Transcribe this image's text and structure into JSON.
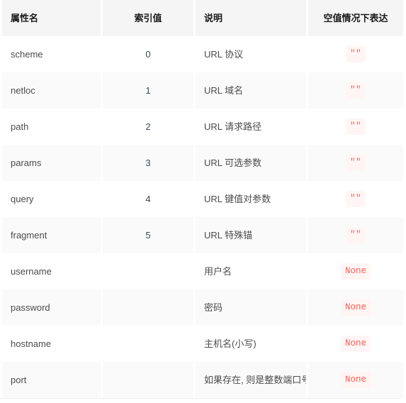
{
  "table": {
    "columns": [
      {
        "label": "属性名",
        "align": "left",
        "key": "attribute"
      },
      {
        "label": "索引值",
        "align": "center",
        "key": "index"
      },
      {
        "label": "说明",
        "align": "left",
        "key": "description"
      },
      {
        "label": "空值情况下表达",
        "align": "center",
        "key": "empty_value"
      }
    ],
    "rows": [
      {
        "attribute": "scheme",
        "index": "0",
        "description": "URL 协议",
        "empty_value": "\"\""
      },
      {
        "attribute": "netloc",
        "index": "1",
        "description": "URL 域名",
        "empty_value": "\"\""
      },
      {
        "attribute": "path",
        "index": "2",
        "description": "URL 请求路径",
        "empty_value": "\"\""
      },
      {
        "attribute": "params",
        "index": "3",
        "description": "URL 可选参数",
        "empty_value": "\"\""
      },
      {
        "attribute": "query",
        "index": "4",
        "description": "URL 键值对参数",
        "empty_value": "\"\""
      },
      {
        "attribute": "fragment",
        "index": "5",
        "description": "URL 特殊锚",
        "empty_value": "\"\""
      },
      {
        "attribute": "username",
        "index": "",
        "description": "用户名",
        "empty_value": "None"
      },
      {
        "attribute": "password",
        "index": "",
        "description": "密码",
        "empty_value": "None"
      },
      {
        "attribute": "hostname",
        "index": "",
        "description": "主机名(小写)",
        "empty_value": "None"
      },
      {
        "attribute": "port",
        "index": "",
        "description": "如果存在, 则是整数端口号",
        "empty_value": "None"
      }
    ]
  },
  "theme": {
    "header_background": "#f5f5f5",
    "header_text": "#1a1a1a",
    "row_background": "#ffffff",
    "row_stripe_background": "#fafafa",
    "body_text": "#4c4c4c",
    "code_text": "#ff5f52",
    "code_background": "#fff5f5"
  }
}
